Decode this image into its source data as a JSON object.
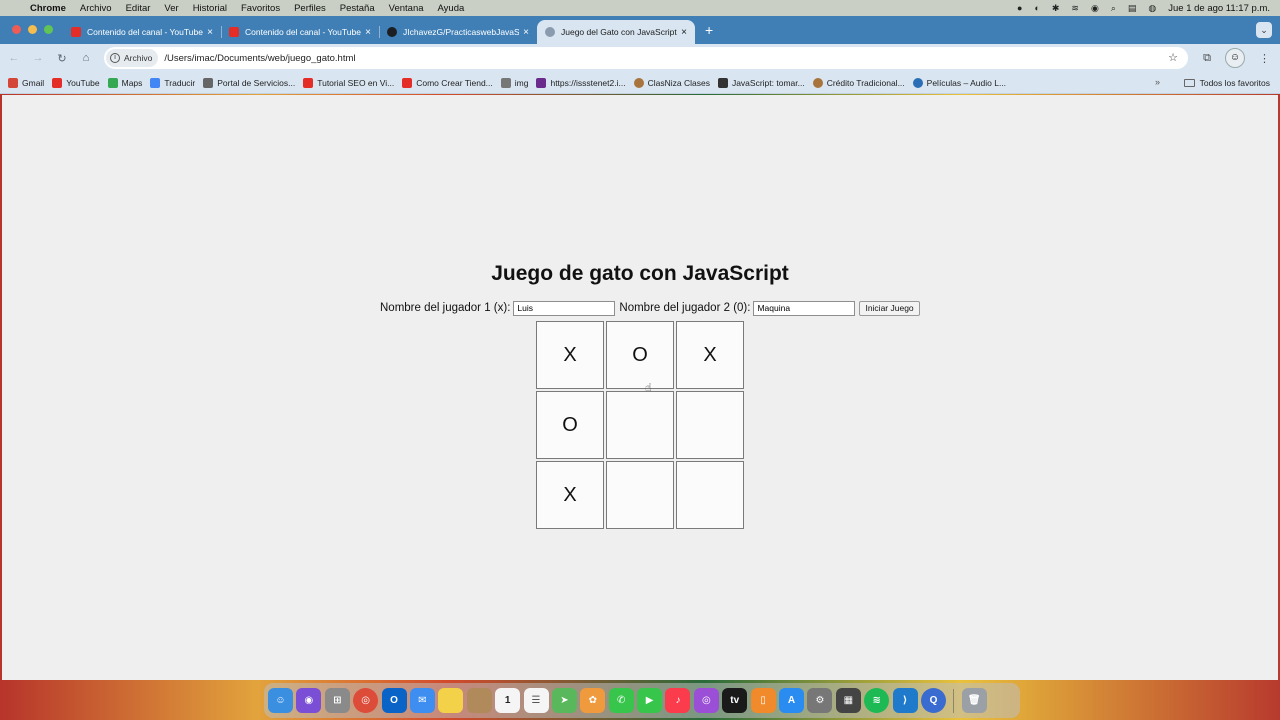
{
  "menubar": {
    "app": "Chrome",
    "items": [
      "Archivo",
      "Editar",
      "Ver",
      "Historial",
      "Favoritos",
      "Perfiles",
      "Pestaña",
      "Ventana",
      "Ayuda"
    ],
    "clock": "Jue 1 de ago  11:17 p.m."
  },
  "tabs": [
    {
      "title": "Contenido del canal - YouTube",
      "icon_color": "#e52d27"
    },
    {
      "title": "Contenido del canal - YouTube",
      "icon_color": "#e52d27"
    },
    {
      "title": "JIchavezG/PracticaswebJavaScript",
      "icon_color": "#1b1f23"
    },
    {
      "title": "Juego del Gato con JavaScript",
      "icon_color": "#8a9bb0"
    }
  ],
  "toolbar": {
    "chip_label": "Archivo",
    "url": "/Users/imac/Documents/web/juego_gato.html"
  },
  "bookmarks": [
    {
      "label": "Gmail",
      "color": "#d44638"
    },
    {
      "label": "YouTube",
      "color": "#e52d27"
    },
    {
      "label": "Maps",
      "color": "#34a853"
    },
    {
      "label": "Traducir",
      "color": "#4285f4"
    },
    {
      "label": "Portal de Servicios...",
      "color": "#666666"
    },
    {
      "label": "Tutorial SEO en Vi...",
      "color": "#e52d27"
    },
    {
      "label": "Como Crear Tiend...",
      "color": "#e52d27"
    },
    {
      "label": "img",
      "color": "#777777"
    },
    {
      "label": "https://issstenet2.i...",
      "color": "#6a2b8c"
    },
    {
      "label": "ClasNiza Clases",
      "color": "#a8743c"
    },
    {
      "label": "JavaScript: tomar...",
      "color": "#333333"
    },
    {
      "label": "Crédito Tradicional...",
      "color": "#a8743c"
    },
    {
      "label": "Películas – Audio L...",
      "color": "#2a6fb5"
    }
  ],
  "bookmarks_more": "»",
  "bookmarks_all": "Todos los favoritos",
  "game": {
    "title": "Juego de gato con JavaScript",
    "player1_label": "Nombre del jugador 1 (x):",
    "player1_value": "Luis",
    "player2_label": "Nombre del jugador 2 (0):",
    "player2_value": "Maquina",
    "start_button": "Iniciar Juego",
    "board": [
      "X",
      "O",
      "X",
      "O",
      "",
      "",
      "X",
      "",
      ""
    ]
  },
  "dock": [
    {
      "name": "finder",
      "color": "#3b8fe0"
    },
    {
      "name": "siri",
      "color": "#7a4fd6"
    },
    {
      "name": "launchpad",
      "color": "#8a8a8a"
    },
    {
      "name": "chrome",
      "color": "#dd4b39"
    },
    {
      "name": "outlook",
      "color": "#0a64c8"
    },
    {
      "name": "mail",
      "color": "#3d8ef0"
    },
    {
      "name": "notes",
      "color": "#f3d24a"
    },
    {
      "name": "contacts",
      "color": "#b08a5a"
    },
    {
      "name": "calendar",
      "color": "#f5f5f5"
    },
    {
      "name": "reminders",
      "color": "#f5f5f5"
    },
    {
      "name": "maps",
      "color": "#59b85c"
    },
    {
      "name": "photos",
      "color": "#f09a3e"
    },
    {
      "name": "messages",
      "color": "#37c54c"
    },
    {
      "name": "facetime",
      "color": "#37c54c"
    },
    {
      "name": "music",
      "color": "#fa3c4c"
    },
    {
      "name": "podcasts",
      "color": "#9b4fd6"
    },
    {
      "name": "tv",
      "color": "#1a1a1a"
    },
    {
      "name": "books",
      "color": "#f08a2a"
    },
    {
      "name": "app-store",
      "color": "#2a8bf0"
    },
    {
      "name": "settings",
      "color": "#777777"
    },
    {
      "name": "calculator",
      "color": "#444444"
    },
    {
      "name": "spotify",
      "color": "#1db954"
    },
    {
      "name": "vscode",
      "color": "#1f7acc"
    },
    {
      "name": "quicktime",
      "color": "#3a6bd0"
    }
  ],
  "dock_labels": {
    "calendar_day": "1",
    "tv": "tv"
  }
}
